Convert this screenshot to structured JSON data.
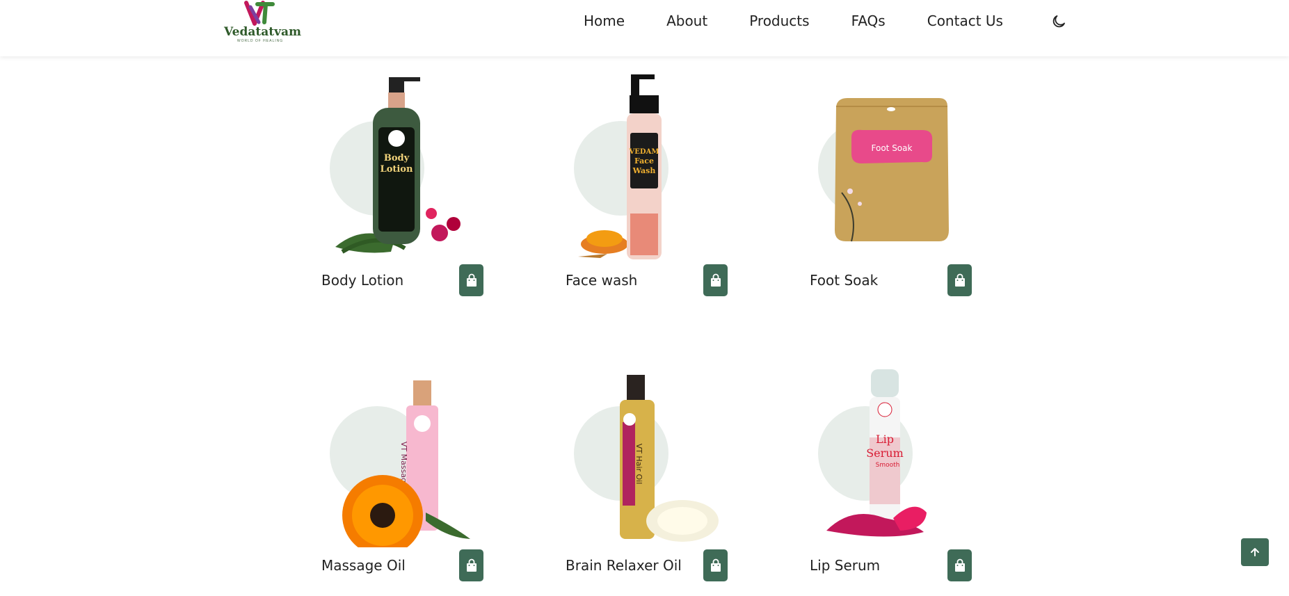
{
  "brand": {
    "name": "Vedatatvam",
    "tagline": "WORLD OF HEALING"
  },
  "nav": {
    "items": [
      {
        "label": "Home"
      },
      {
        "label": "About"
      },
      {
        "label": "Products"
      },
      {
        "label": "FAQs"
      },
      {
        "label": "Contact Us"
      }
    ],
    "theme_toggle_icon": "moon-icon"
  },
  "products": [
    {
      "name": "Body Lotion",
      "label_lines": [
        "Body",
        "Lotion"
      ],
      "bottle_color": "#3d5a3f",
      "accent": "#c2185b"
    },
    {
      "name": "Face wash",
      "label_lines": [
        "VEDAM",
        "Face",
        "Wash"
      ],
      "bottle_color": "#f3d2c9",
      "accent": "#e67e22"
    },
    {
      "name": "Foot Soak",
      "label_lines": [
        "Foot Soak"
      ],
      "bottle_color": "#c9a35a",
      "accent": "#e84a8a"
    },
    {
      "name": "Massage Oil",
      "label_lines": [
        "VT Massage Oil"
      ],
      "bottle_color": "#f7b8cf",
      "accent": "#f57c00"
    },
    {
      "name": "Brain Relaxer Oil",
      "label_lines": [
        "VT Hair Oil"
      ],
      "bottle_color": "#d7b24a",
      "accent": "#f4f0dc"
    },
    {
      "name": "Lip Serum",
      "label_lines": [
        "Lip",
        "Serum",
        "Smooth"
      ],
      "bottle_color": "#f5f5f5",
      "accent": "#c2185b"
    }
  ],
  "cart_icon": "shopping-bag-icon",
  "scroll_top_icon": "arrow-up-icon",
  "colors": {
    "primary": "#3f6b57",
    "circle": "#e7ede9"
  }
}
